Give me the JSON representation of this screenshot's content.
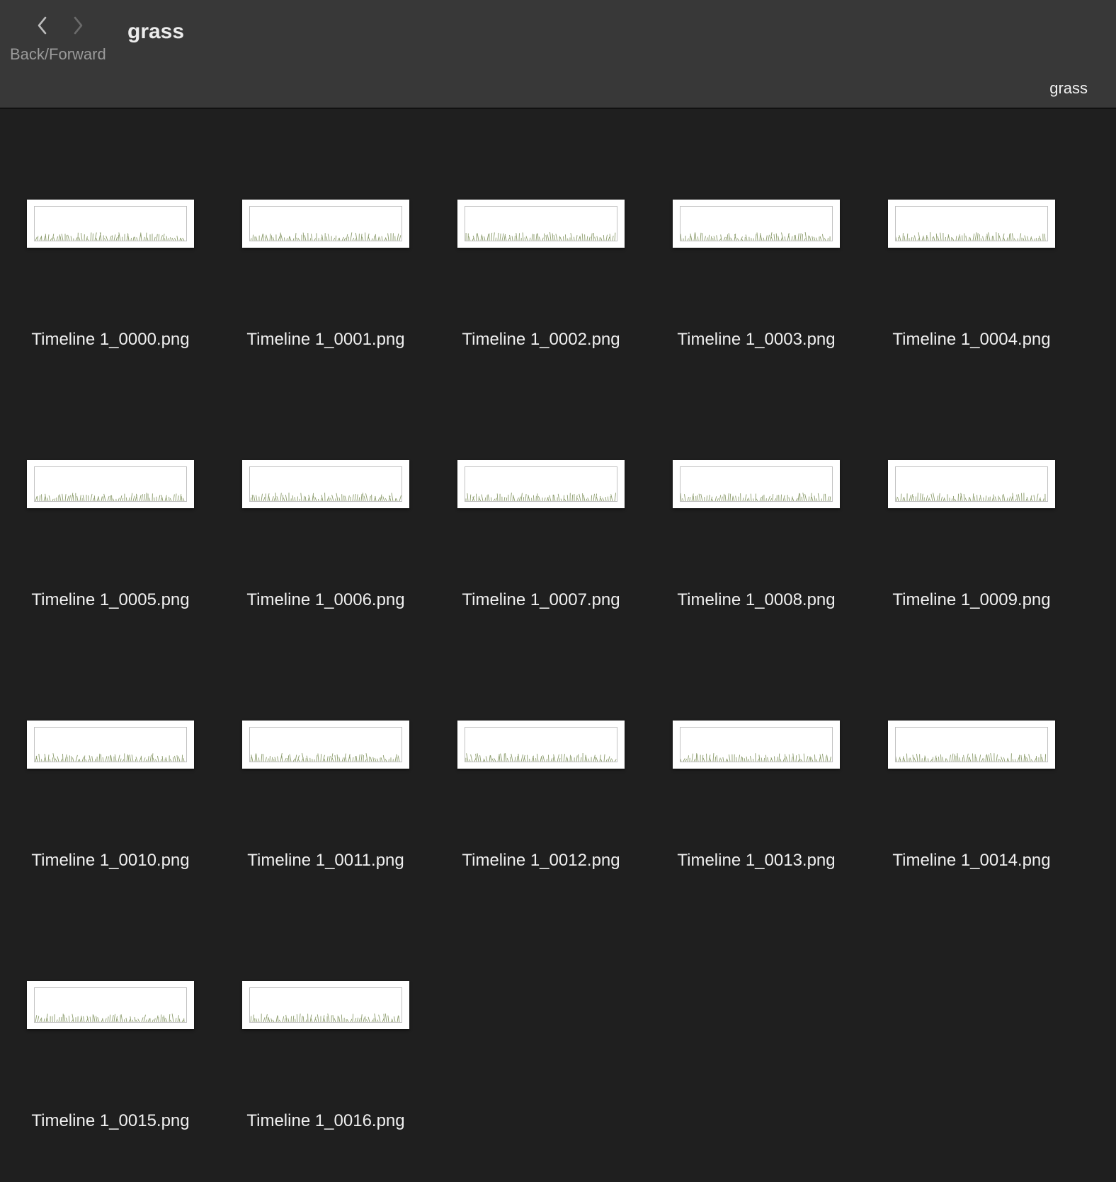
{
  "toolbar": {
    "back_icon": "chevron-left-icon",
    "forward_icon": "chevron-right-icon",
    "nav_caption": "Back/Forward",
    "title": "grass",
    "path_label": "grass"
  },
  "files": [
    {
      "name": "Timeline 1_0000.png"
    },
    {
      "name": "Timeline 1_0001.png"
    },
    {
      "name": "Timeline 1_0002.png"
    },
    {
      "name": "Timeline 1_0003.png"
    },
    {
      "name": "Timeline 1_0004.png"
    },
    {
      "name": "Timeline 1_0005.png"
    },
    {
      "name": "Timeline 1_0006.png"
    },
    {
      "name": "Timeline 1_0007.png"
    },
    {
      "name": "Timeline 1_0008.png"
    },
    {
      "name": "Timeline 1_0009.png"
    },
    {
      "name": "Timeline 1_0010.png"
    },
    {
      "name": "Timeline 1_0011.png"
    },
    {
      "name": "Timeline 1_0012.png"
    },
    {
      "name": "Timeline 1_0013.png"
    },
    {
      "name": "Timeline 1_0014.png"
    },
    {
      "name": "Timeline 1_0015.png"
    },
    {
      "name": "Timeline 1_0016.png"
    }
  ],
  "colors": {
    "background": "#1f1f1f",
    "toolbar": "#383838",
    "grass": "#8a9a6a"
  }
}
